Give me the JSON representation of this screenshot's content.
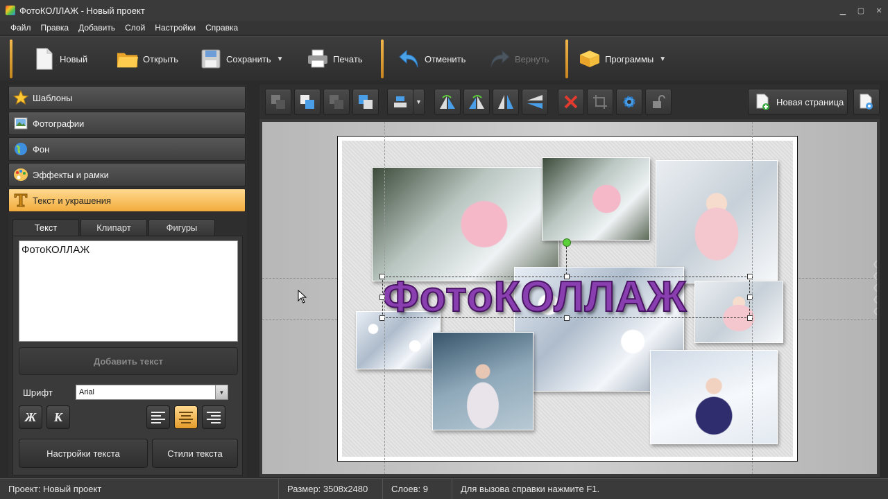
{
  "window": {
    "title": "ФотоКОЛЛАЖ - Новый проект"
  },
  "menu": [
    "Файл",
    "Правка",
    "Добавить",
    "Слой",
    "Настройки",
    "Справка"
  ],
  "toolbar": {
    "new_label": "Новый",
    "open_label": "Открыть",
    "save_label": "Сохранить",
    "print_label": "Печать",
    "undo_label": "Отменить",
    "redo_label": "Вернуть",
    "programs_label": "Программы"
  },
  "sidebar": {
    "sections": [
      {
        "label": "Шаблоны",
        "icon": "star-icon"
      },
      {
        "label": "Фотографии",
        "icon": "photo-icon"
      },
      {
        "label": "Фон",
        "icon": "globe-icon"
      },
      {
        "label": "Эффекты и рамки",
        "icon": "palette-icon"
      },
      {
        "label": "Текст и украшения",
        "icon": "text-icon",
        "active": true
      }
    ],
    "tabs": [
      {
        "label": "Текст",
        "active": true
      },
      {
        "label": "Клипарт"
      },
      {
        "label": "Фигуры"
      }
    ],
    "text_value": "ФотоКОЛЛАЖ",
    "add_text_label": "Добавить текст",
    "font_label": "Шрифт",
    "font_value": "Arial",
    "bold_label": "Ж",
    "italic_label": "К",
    "text_settings_label": "Настройки текста",
    "text_styles_label": "Стили текста"
  },
  "canvas": {
    "new_page_label": "Новая страница",
    "collage_text": "ФотоКОЛЛАЖ"
  },
  "status": {
    "project": "Проект: Новый проект",
    "size": "Размер: 3508x2480",
    "layers": "Слоев: 9",
    "help": "Для вызова справки нажмите F1."
  },
  "colors": {
    "accent": "#f2ac3c",
    "title_text": "#8a3fb0",
    "delete": "#e23a2e",
    "rotate_handle": "#5cd03a"
  }
}
